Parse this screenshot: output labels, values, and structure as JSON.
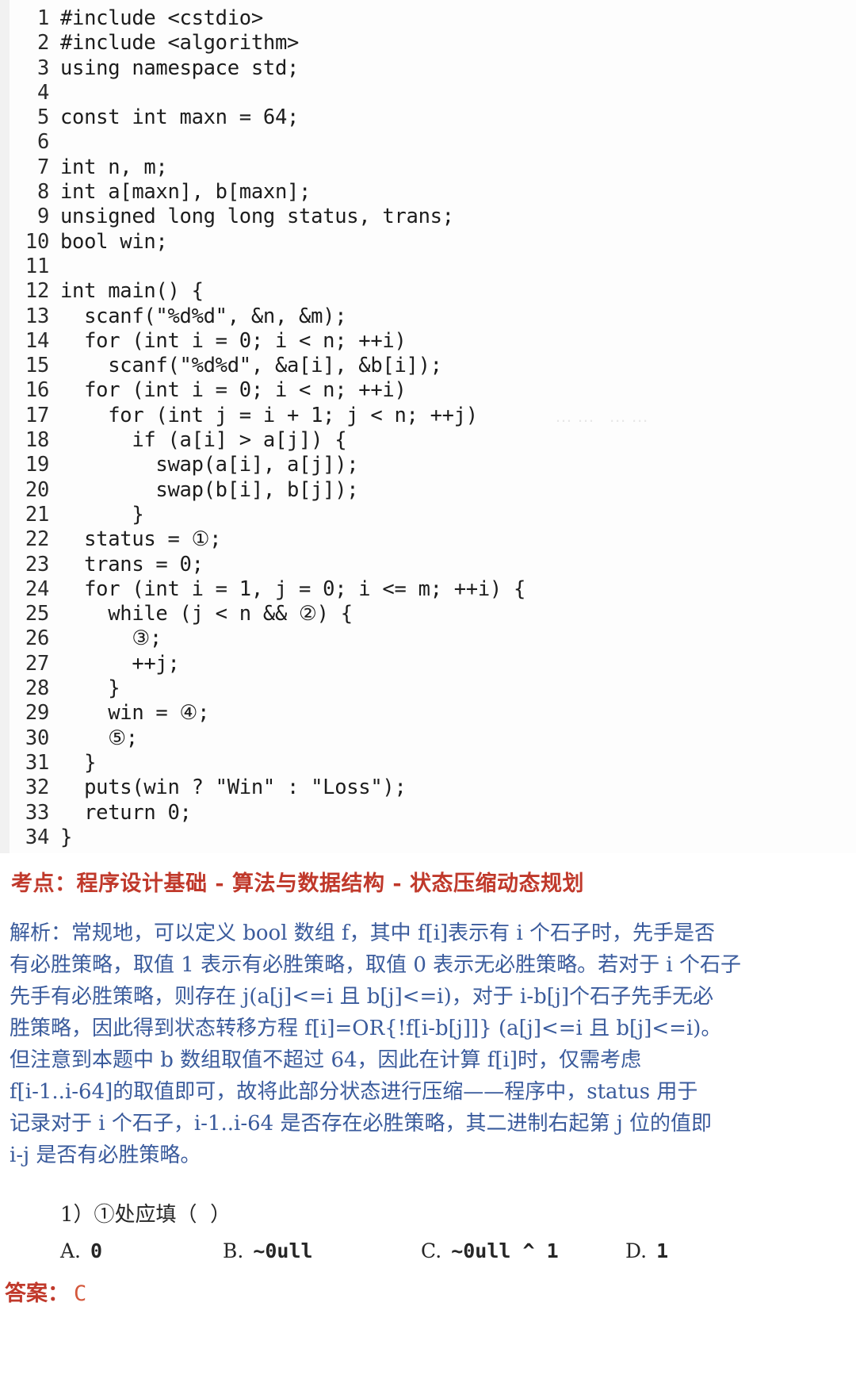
{
  "colors": {
    "keypoint_red": "#c0392b",
    "analysis_blue": "#3a5b9c",
    "answer_red": "#d4583c",
    "code_text": "#1c1c1c",
    "page_background": "#ffffff"
  },
  "watermark": {
    "text": "……  ……"
  },
  "code": {
    "language": "C++",
    "lines": [
      {
        "n": "1",
        "text": "#include <cstdio>"
      },
      {
        "n": "2",
        "text": "#include <algorithm>"
      },
      {
        "n": "3",
        "text": "using namespace std;"
      },
      {
        "n": "4",
        "text": ""
      },
      {
        "n": "5",
        "text": "const int maxn = 64;"
      },
      {
        "n": "6",
        "text": ""
      },
      {
        "n": "7",
        "text": "int n, m;"
      },
      {
        "n": "8",
        "text": "int a[maxn], b[maxn];"
      },
      {
        "n": "9",
        "text": "unsigned long long status, trans;"
      },
      {
        "n": "10",
        "text": "bool win;"
      },
      {
        "n": "11",
        "text": ""
      },
      {
        "n": "12",
        "text": "int main() {"
      },
      {
        "n": "13",
        "text": "  scanf(\"%d%d\", &n, &m);"
      },
      {
        "n": "14",
        "text": "  for (int i = 0; i < n; ++i)"
      },
      {
        "n": "15",
        "text": "    scanf(\"%d%d\", &a[i], &b[i]);"
      },
      {
        "n": "16",
        "text": "  for (int i = 0; i < n; ++i)"
      },
      {
        "n": "17",
        "text": "    for (int j = i + 1; j < n; ++j)"
      },
      {
        "n": "18",
        "text": "      if (a[i] > a[j]) {"
      },
      {
        "n": "19",
        "text": "        swap(a[i], a[j]);"
      },
      {
        "n": "20",
        "text": "        swap(b[i], b[j]);"
      },
      {
        "n": "21",
        "text": "      }"
      },
      {
        "n": "22",
        "text": "  status = ①;"
      },
      {
        "n": "23",
        "text": "  trans = 0;"
      },
      {
        "n": "24",
        "text": "  for (int i = 1, j = 0; i <= m; ++i) {"
      },
      {
        "n": "25",
        "text": "    while (j < n && ②) {"
      },
      {
        "n": "26",
        "text": "      ③;"
      },
      {
        "n": "27",
        "text": "      ++j;"
      },
      {
        "n": "28",
        "text": "    }"
      },
      {
        "n": "29",
        "text": "    win = ④;"
      },
      {
        "n": "30",
        "text": "    ⑤;"
      },
      {
        "n": "31",
        "text": "  }"
      },
      {
        "n": "32",
        "text": "  puts(win ? \"Win\" : \"Loss\");"
      },
      {
        "n": "33",
        "text": "  return 0;"
      },
      {
        "n": "34",
        "text": "}"
      }
    ]
  },
  "keypoint": {
    "text": "考点：程序设计基础 - 算法与数据结构 - 状态压缩动态规划"
  },
  "analysis": {
    "lines": [
      "解析：常规地，可以定义 bool 数组 f，其中 f[i]表示有 i 个石子时，先手是否",
      "有必胜策略，取值 1 表示有必胜策略，取值 0 表示无必胜策略。若对于 i 个石子",
      "先手有必胜策略，则存在 j(a[j]<=i 且 b[j]<=i)，对于 i-b[j]个石子先手无必",
      "胜策略，因此得到状态转移方程 f[i]=OR{!f[i-b[j]]} (a[j]<=i 且 b[j]<=i)。",
      "但注意到本题中 b 数组取值不超过 64，因此在计算 f[i]时，仅需考虑",
      "f[i-1..i-64]的取值即可，故将此部分状态进行压缩——程序中，status 用于",
      "记录对于 i 个石子，i-1..i-64 是否存在必胜策略，其二进制右起第 j 位的值即",
      "i-j 是否有必胜策略。"
    ]
  },
  "question": {
    "stem": "1）①处应填（  ）",
    "options": [
      {
        "letter": "A.",
        "text": "0"
      },
      {
        "letter": "B.",
        "text": "~0ull"
      },
      {
        "letter": "C.",
        "text": "~0ull ^ 1"
      },
      {
        "letter": "D.",
        "text": "1"
      }
    ]
  },
  "answer": {
    "label": "答案：",
    "value": "C"
  }
}
